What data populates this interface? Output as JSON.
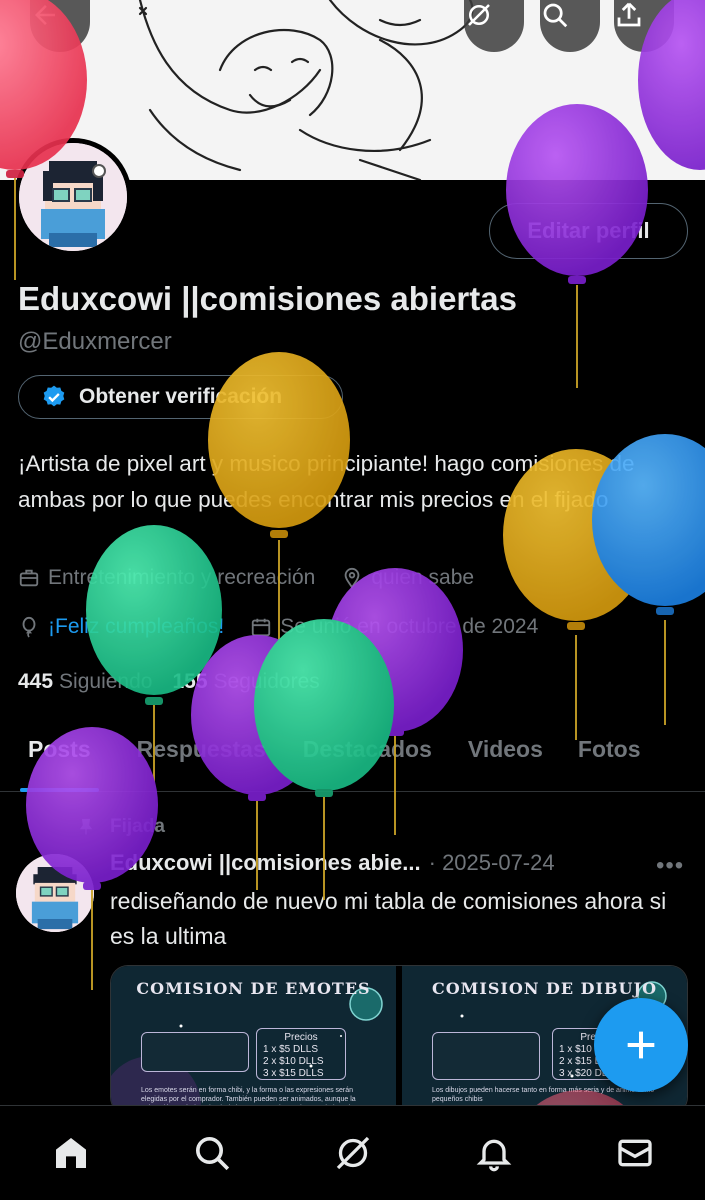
{
  "profile": {
    "display_name": "Eduxcowi ||comisiones abiertas",
    "handle": "@Eduxmercer",
    "edit_label": "Editar perfil",
    "verify_label": "Obtener verificación",
    "bio": "¡Artista de pixel art y musico principiante! hago comisiones de ambas por lo que puedes encontrar mis precios en el fijado",
    "category": "Entretenimiento y recreación",
    "location": "quien sabe",
    "birthday": "¡Feliz cumpleaños!",
    "joined": "Se unió en octubre de 2024",
    "following_count": "445",
    "following_label": "Siguiendo",
    "followers_count": "155",
    "followers_label": "Seguidores"
  },
  "tabs": [
    {
      "label": "Posts",
      "active": true
    },
    {
      "label": "Respuestas",
      "active": false
    },
    {
      "label": "Destacados",
      "active": false
    },
    {
      "label": "Videos",
      "active": false
    },
    {
      "label": "Fotos",
      "active": false
    }
  ],
  "pinned_post": {
    "pinned_label": "Fijada",
    "author": "Eduxcowi ||comisiones abie...",
    "date": "· 2025-07-24",
    "more": "•••",
    "text": "rediseñando de nuevo mi tabla de comisiones ahora si es la ultima",
    "images": [
      {
        "title": "COMISION DE EMOTES",
        "price_header": "Precios",
        "prices": [
          "1 x $5   DLLS",
          "2 x $10 DLLS",
          "3 x $15 DLLS"
        ],
        "footnote": "Los emotes serán en forma chibi, y la forma o las expresiones serán elegidas por el comprador. También pueden ser animados, aunque la animación será algo simple (mientras aprendo a animar mejor), y el"
      },
      {
        "title": "COMISION DE DIBUJO",
        "price_header": "Precios",
        "prices": [
          "1 x $10 DLLS",
          "2 x $15 DLLS",
          "3 x $20 DLLS"
        ],
        "footnote": "Los dibujos pueden hacerse tanto en forma más seria y de anime como pequeños chibis"
      }
    ]
  },
  "icons": {
    "back": "arrow-left-icon",
    "grok": "grok-icon",
    "search": "search-icon",
    "share": "share-icon",
    "verified": "verified-badge-icon",
    "briefcase": "briefcase-icon",
    "location": "location-pin-icon",
    "balloon": "balloon-icon",
    "calendar": "calendar-icon",
    "pin": "pin-icon",
    "compose": "plus-icon",
    "home": "home-icon",
    "notifications": "bell-icon",
    "messages": "mail-icon"
  },
  "colors": {
    "accent": "#1d9bf0",
    "muted": "#71767b",
    "text": "#e7e9ea",
    "border": "#536471"
  }
}
